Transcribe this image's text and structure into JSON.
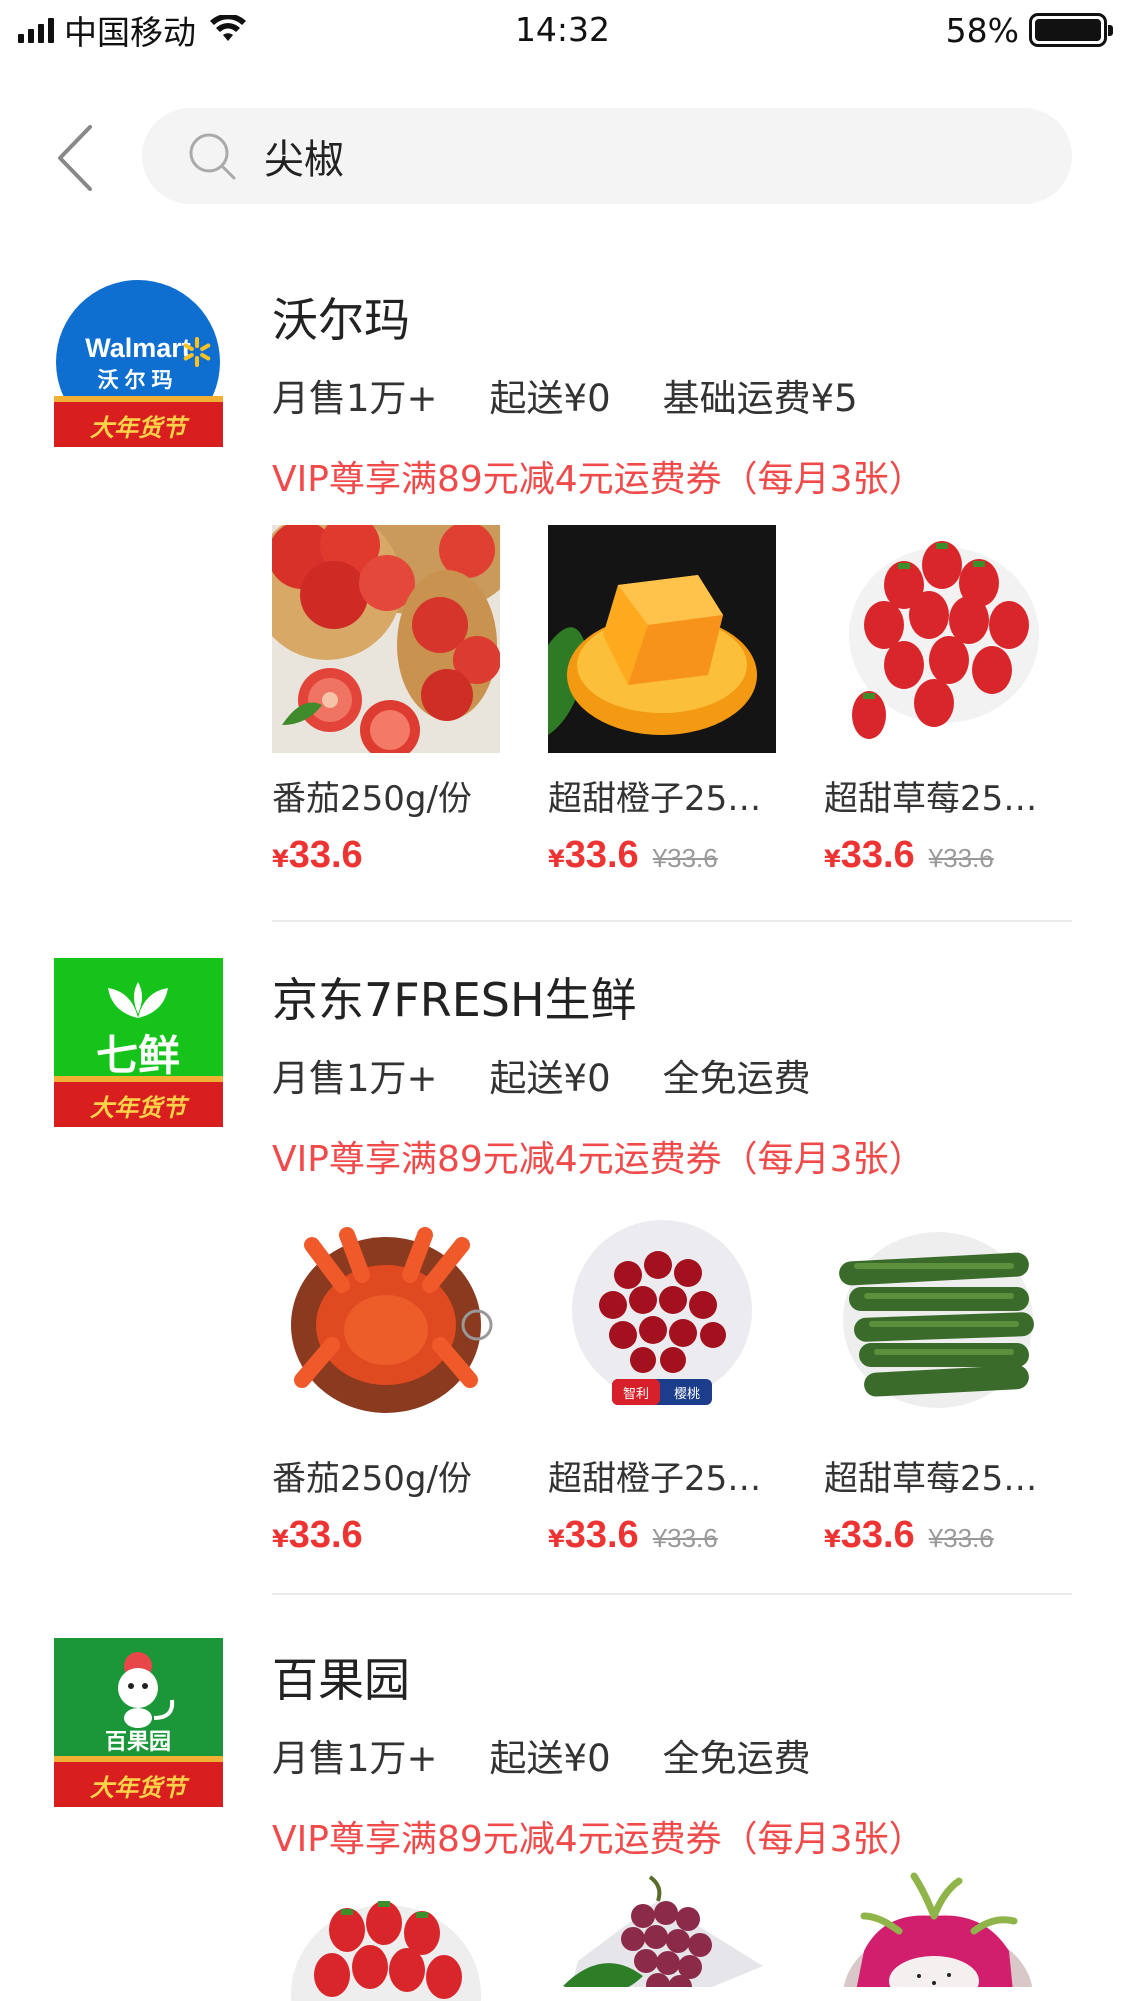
{
  "status_bar": {
    "carrier": "中国移动",
    "time": "14:32",
    "battery": "58%"
  },
  "search": {
    "query": "尖椒"
  },
  "stores": [
    {
      "name": "沃尔玛",
      "logo_text_en": "Walmart",
      "logo_text_cn": "沃尔玛",
      "logo_banner": "大年货节",
      "sales": "月售1万+",
      "min_order": "起送¥0",
      "delivery_fee": "基础运费¥5",
      "promo": "VIP尊享满89元减4元运费券（每月3张）",
      "products": [
        {
          "name": "番茄250g/份",
          "price_symbol": "¥",
          "price": "33.6",
          "old_price": "",
          "image": "tomato"
        },
        {
          "name": "超甜橙子25…",
          "price_symbol": "¥",
          "price": "33.6",
          "old_price": "¥33.6",
          "image": "orange"
        },
        {
          "name": "超甜草莓25…",
          "price_symbol": "¥",
          "price": "33.6",
          "old_price": "¥33.6",
          "image": "strawberry"
        }
      ]
    },
    {
      "name": "京东7FRESH生鲜",
      "logo_text_cn": "七鲜",
      "logo_banner": "大年货节",
      "sales": "月售1万+",
      "min_order": "起送¥0",
      "delivery_fee": "全免运费",
      "promo": "VIP尊享满89元减4元运费券（每月3张）",
      "products": [
        {
          "name": "番茄250g/份",
          "price_symbol": "¥",
          "price": "33.6",
          "old_price": "",
          "image": "crab"
        },
        {
          "name": "超甜橙子25…",
          "price_symbol": "¥",
          "price": "33.6",
          "old_price": "¥33.6",
          "image": "cherry",
          "badge_left": "智利",
          "badge_right": "樱桃"
        },
        {
          "name": "超甜草莓25…",
          "price_symbol": "¥",
          "price": "33.6",
          "old_price": "¥33.6",
          "image": "cucumber"
        }
      ]
    },
    {
      "name": "百果园",
      "logo_text_cn": "百果园",
      "logo_banner": "大年货节",
      "sales": "月售1万+",
      "min_order": "起送¥0",
      "delivery_fee": "全免运费",
      "promo": "VIP尊享满89元减4元运费券（每月3张）",
      "products": [
        {
          "image": "strawberry-plate"
        },
        {
          "image": "grapes"
        },
        {
          "image": "dragonfruit"
        }
      ]
    }
  ],
  "colors": {
    "accent_red": "#f04a4a",
    "price_red": "#ee3333",
    "walmart_blue": "#0071ce",
    "fresh_green": "#1ec31e",
    "baiguo_green": "#1a9a3a"
  }
}
